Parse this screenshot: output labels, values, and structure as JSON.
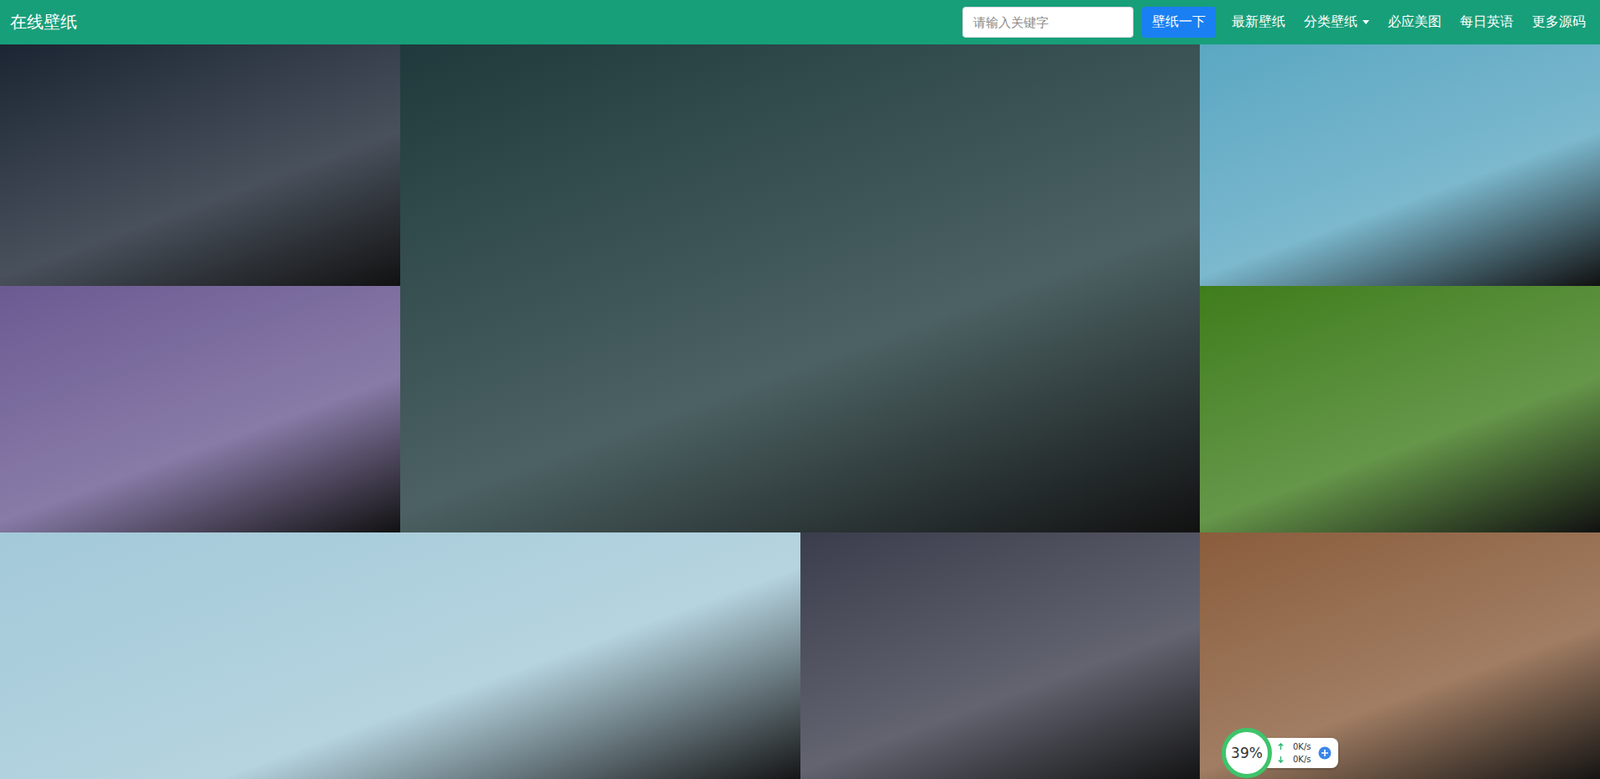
{
  "navbar": {
    "brand": "在线壁纸",
    "search": {
      "placeholder": "请输入关键字",
      "button": "壁纸一下"
    },
    "links": [
      {
        "label": "最新壁纸",
        "dropdown": false
      },
      {
        "label": "分类壁纸",
        "dropdown": true
      },
      {
        "label": "必应美图",
        "dropdown": false
      },
      {
        "label": "每日英语",
        "dropdown": false
      },
      {
        "label": "更多源码",
        "dropdown": false
      }
    ]
  },
  "tiles": [
    {
      "kind": "normal",
      "color": "#1b2533"
    },
    {
      "kind": "large",
      "color": "#1f3a3c"
    },
    {
      "kind": "normal",
      "color": "#5ba7c2"
    },
    {
      "kind": "normal",
      "color": "#6b5a92"
    },
    {
      "kind": "normal",
      "color": "#3f7d1c"
    },
    {
      "kind": "wide",
      "color": "#a3c9d8"
    },
    {
      "kind": "normal",
      "color": "#3b3d4c"
    },
    {
      "kind": "normal",
      "color": "#8a5d3c"
    }
  ],
  "speed_widget": {
    "percent": "39%",
    "upload": "0K/s",
    "download": "0K/s"
  }
}
